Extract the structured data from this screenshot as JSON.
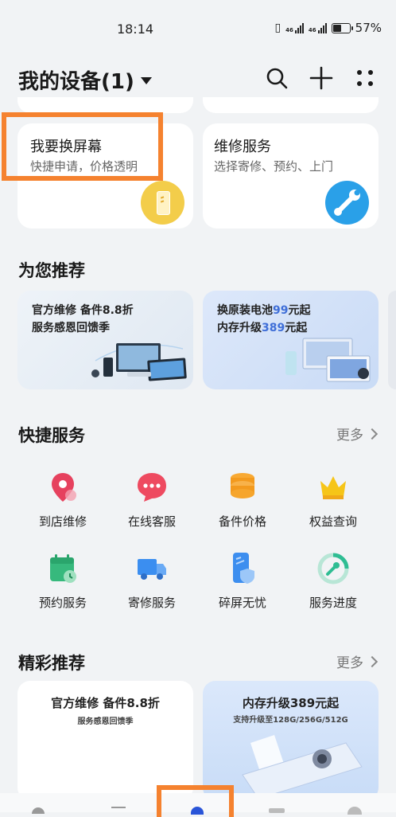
{
  "status_bar": {
    "time": "18:14",
    "net_label": "46",
    "battery_pct": "57%",
    "battery_level": 0.57
  },
  "header": {
    "title": "我的设备(1)"
  },
  "cards": [
    {
      "title": "我要换屏幕",
      "subtitle": "快捷申请，价格透明"
    },
    {
      "title": "维修服务",
      "subtitle": "选择寄修、预约、上门"
    }
  ],
  "recommend": {
    "title": "为您推荐",
    "banners": [
      {
        "line1": "官方维修 备件8.8折",
        "line2": "服务感恩回馈季"
      },
      {
        "line1_a": "换原装电池",
        "line1_b": "99",
        "line1_c": "元起",
        "line2_a": "内存升级",
        "line2_b": "389",
        "line2_c": "元起"
      }
    ]
  },
  "quick": {
    "title": "快捷服务",
    "more": "更多",
    "items": [
      {
        "label": "到店维修"
      },
      {
        "label": "在线客服"
      },
      {
        "label": "备件价格"
      },
      {
        "label": "权益查询"
      },
      {
        "label": "预约服务"
      },
      {
        "label": "寄修服务"
      },
      {
        "label": "碎屏无忧"
      },
      {
        "label": "服务进度"
      }
    ]
  },
  "featured": {
    "title": "精彩推荐",
    "more": "更多",
    "cards": [
      {
        "title": "官方维修 备件8.8折",
        "subtitle": "服务感恩回馈季"
      },
      {
        "title": "内存升级389元起",
        "subtitle": "支持升级至128G/256G/512G"
      }
    ]
  },
  "colors": {
    "highlight": "#f5822f",
    "accent_blue": "#2aa0e8",
    "accent_yellow": "#f3cd4a",
    "price_blue": "#3f6fd8"
  }
}
